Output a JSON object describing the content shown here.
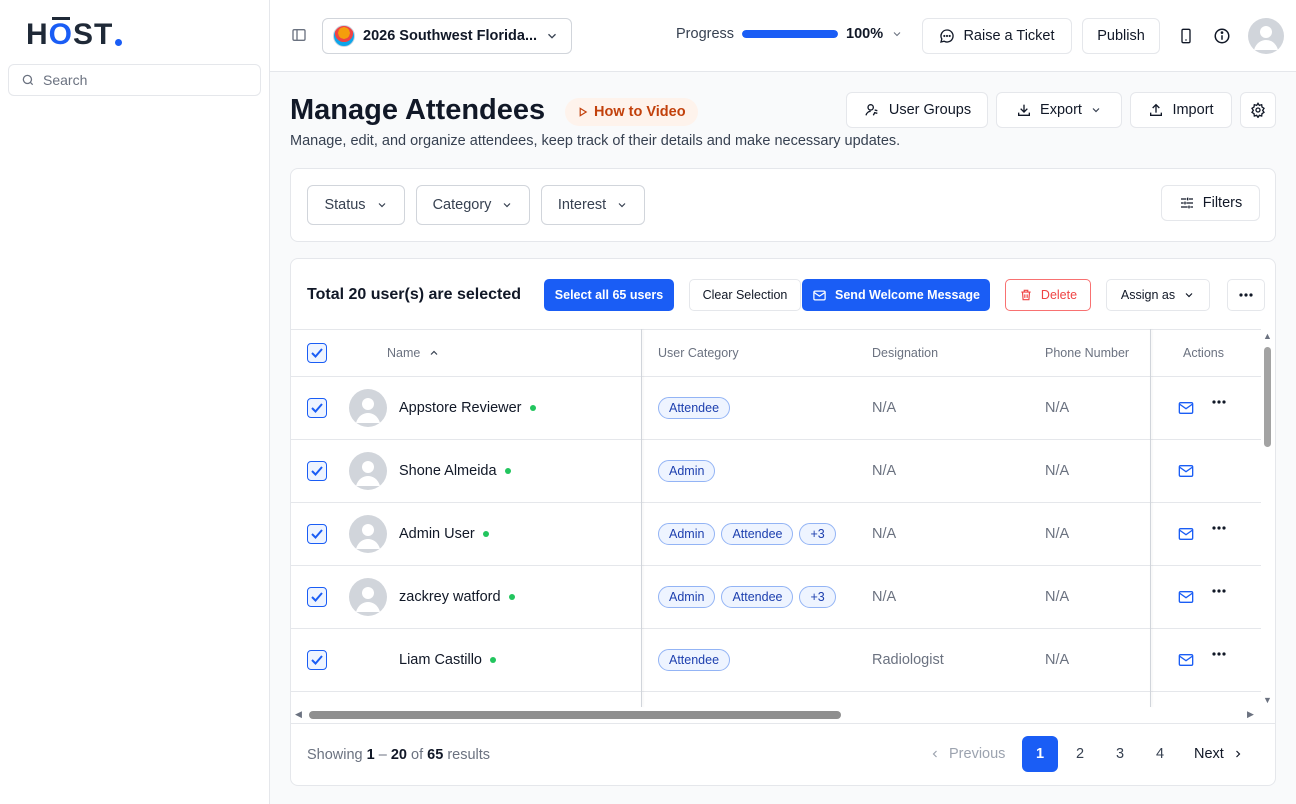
{
  "brand": {
    "logo_h": "H",
    "logo_o": "O",
    "logo_rest": "ST"
  },
  "sidebar": {
    "search_placeholder": "Search"
  },
  "topbar": {
    "event_name": "2026 Southwest Florida...",
    "progress_label": "Progress",
    "progress_value": 100,
    "progress_text": "100%",
    "raise_ticket": "Raise a Ticket",
    "publish": "Publish"
  },
  "header": {
    "title": "Manage Attendees",
    "how_to": "How to Video",
    "subtitle": "Manage, edit, and organize attendees, keep track of their details and make necessary updates.",
    "user_groups": "User Groups",
    "export": "Export",
    "import": "Import"
  },
  "filters": {
    "status": "Status",
    "category": "Category",
    "interest": "Interest",
    "filters_button": "Filters"
  },
  "selection": {
    "text": "Total 20 user(s) are selected",
    "select_all": "Select all 65 users",
    "clear": "Clear Selection",
    "welcome": "Send Welcome Message",
    "delete": "Delete",
    "assign": "Assign as"
  },
  "table": {
    "columns": {
      "name": "Name",
      "category": "User Category",
      "designation": "Designation",
      "phone": "Phone Number",
      "actions": "Actions"
    },
    "rows": [
      {
        "name": "Appstore Reviewer",
        "tags": [
          "Attendee"
        ],
        "designation": "N/A",
        "phone": "N/A",
        "avatar": true,
        "more": true
      },
      {
        "name": "Shone Almeida",
        "tags": [
          "Admin"
        ],
        "designation": "N/A",
        "phone": "N/A",
        "avatar": true,
        "more": false
      },
      {
        "name": "Admin User",
        "tags": [
          "Admin",
          "Attendee",
          "+3"
        ],
        "designation": "N/A",
        "phone": "N/A",
        "avatar": true,
        "more": true
      },
      {
        "name": "zackrey watford",
        "tags": [
          "Admin",
          "Attendee",
          "+3"
        ],
        "designation": "N/A",
        "phone": "N/A",
        "avatar": true,
        "more": true
      },
      {
        "name": "Liam Castillo",
        "tags": [
          "Attendee"
        ],
        "designation": "Radiologist",
        "phone": "N/A",
        "avatar": false,
        "more": true
      }
    ]
  },
  "pagination": {
    "showing_prefix": "Showing",
    "range_start": "1",
    "range_sep": " – ",
    "range_end": "20",
    "of_word": "of",
    "total": "65",
    "results_word": "results",
    "previous": "Previous",
    "pages": [
      "1",
      "2",
      "3",
      "4"
    ],
    "active_page": "1",
    "next": "Next"
  },
  "colors": {
    "accent": "#1a5df5",
    "danger": "#ef4444",
    "online": "#22c55e",
    "howto_text": "#c2410c"
  }
}
